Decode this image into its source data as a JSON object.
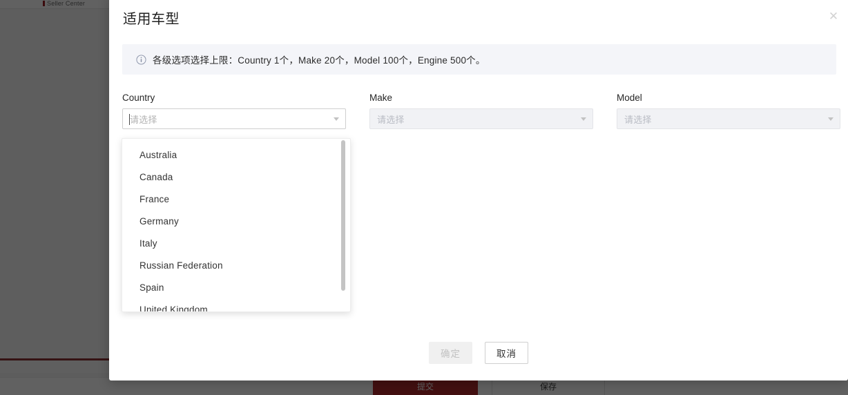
{
  "background": {
    "brand": "Seller Center",
    "action_bar": {
      "submit_label": "提交",
      "save_label": "保存"
    }
  },
  "modal": {
    "title": "适用车型",
    "close_icon": "close-icon",
    "banner": {
      "icon": "info-circle-icon",
      "text": "各级选项选择上限：Country 1个，Make 20个，Model 100个，Engine 500个。"
    },
    "fields": [
      {
        "label": "Country",
        "placeholder": "请选择",
        "state": "active",
        "caret_icon": "chevron-down-icon"
      },
      {
        "label": "Make",
        "placeholder": "请选择",
        "state": "disabled",
        "caret_icon": "chevron-down-icon"
      },
      {
        "label": "Model",
        "placeholder": "请选择",
        "state": "disabled",
        "caret_icon": "chevron-down-icon"
      }
    ],
    "dropdown": {
      "options": [
        "Australia",
        "Canada",
        "France",
        "Germany",
        "Italy",
        "Russian Federation",
        "Spain",
        "United Kingdom"
      ]
    },
    "footer": {
      "confirm_label": "确定",
      "cancel_label": "取消"
    }
  },
  "colors": {
    "banner_bg": "#f4f5f9",
    "overlay": "rgba(0,0,0,0.62)",
    "brand_red": "#b02b2f",
    "disabled_text": "#c2c2c2"
  }
}
